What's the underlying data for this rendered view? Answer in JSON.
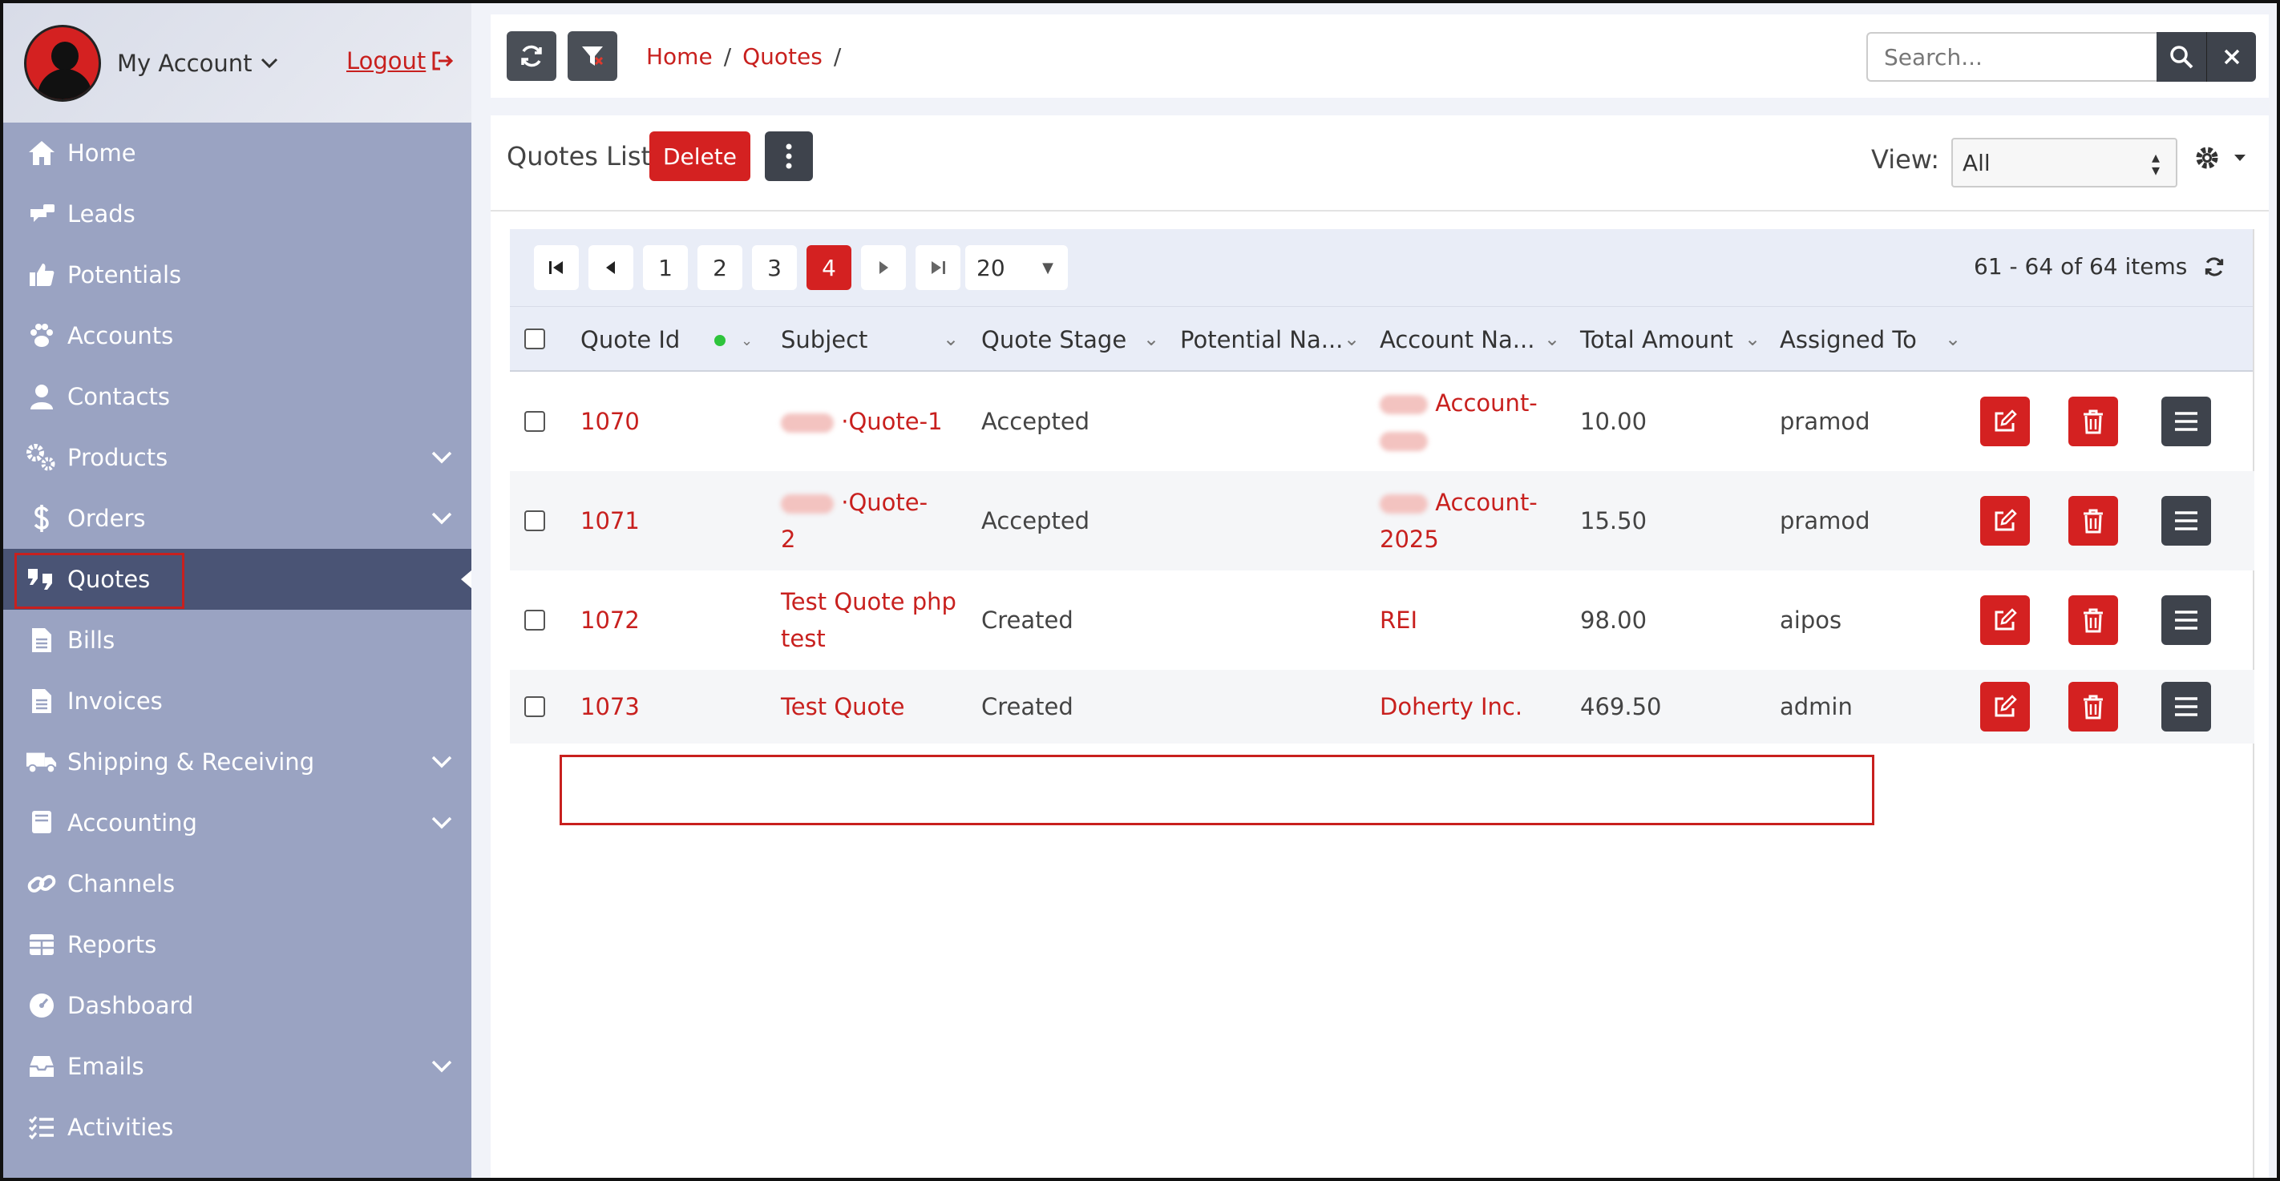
{
  "account": {
    "name": "My Account",
    "logout": "Logout"
  },
  "sidebar": {
    "items": [
      {
        "label": "Home",
        "icon": "home-icon"
      },
      {
        "label": "Leads",
        "icon": "leads-icon"
      },
      {
        "label": "Potentials",
        "icon": "thumbs-up-icon"
      },
      {
        "label": "Accounts",
        "icon": "paw-icon"
      },
      {
        "label": "Contacts",
        "icon": "user-icon"
      },
      {
        "label": "Products",
        "icon": "cogs-icon",
        "expandable": true
      },
      {
        "label": "Orders",
        "icon": "dollar-icon",
        "expandable": true
      },
      {
        "label": "Quotes",
        "icon": "quote-icon",
        "active": true
      },
      {
        "label": "Bills",
        "icon": "file-icon"
      },
      {
        "label": "Invoices",
        "icon": "file-text-icon"
      },
      {
        "label": "Shipping & Receiving",
        "icon": "truck-icon",
        "expandable": true
      },
      {
        "label": "Accounting",
        "icon": "book-icon",
        "expandable": true
      },
      {
        "label": "Channels",
        "icon": "link-icon"
      },
      {
        "label": "Reports",
        "icon": "table-icon"
      },
      {
        "label": "Dashboard",
        "icon": "dashboard-icon"
      },
      {
        "label": "Emails",
        "icon": "inbox-icon",
        "expandable": true
      },
      {
        "label": "Activities",
        "icon": "tasks-icon"
      }
    ]
  },
  "breadcrumb": {
    "home": "Home",
    "quotes": "Quotes",
    "sep": "/"
  },
  "search": {
    "placeholder": "Search..."
  },
  "page": {
    "title": "Quotes List",
    "delete": "Delete",
    "view_label": "View:",
    "view_value": "All"
  },
  "pager": {
    "pages": [
      "1",
      "2",
      "3",
      "4"
    ],
    "current": "4",
    "page_size": "20",
    "info": "61 - 64 of 64 items"
  },
  "columns": [
    "Quote Id",
    "Subject",
    "Quote Stage",
    "Potential Na...",
    "Account Na...",
    "Total Amount",
    "Assigned To"
  ],
  "rows": [
    {
      "id": "1070",
      "subject_a": "Quote-1",
      "subject_b": "",
      "stage": "Accepted",
      "account_a": "Account-",
      "account_b": "",
      "total": "10.00",
      "assigned": "pramod"
    },
    {
      "id": "1071",
      "subject_a": "Quote-",
      "subject_b": "2",
      "stage": "Accepted",
      "account_a": "Account-",
      "account_b": "2025",
      "total": "15.50",
      "assigned": "pramod"
    },
    {
      "id": "1072",
      "subject_a": "Test Quote php",
      "subject_b": "test",
      "stage": "Created",
      "account_a": "REI",
      "account_b": "",
      "total": "98.00",
      "assigned": "aipos"
    },
    {
      "id": "1073",
      "subject_a": "Test Quote",
      "subject_b": "",
      "stage": "Created",
      "account_a": "Doherty Inc.",
      "account_b": "",
      "total": "469.50",
      "assigned": "admin"
    }
  ],
  "colors": {
    "accent": "#d42121",
    "sidebar": "#9aa3c2",
    "active": "#4a5475",
    "dark_button": "#3e434c"
  }
}
